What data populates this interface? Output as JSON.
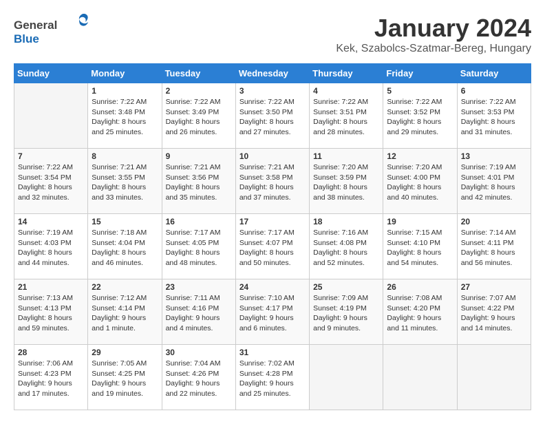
{
  "header": {
    "logo_general": "General",
    "logo_blue": "Blue",
    "month": "January 2024",
    "location": "Kek, Szabolcs-Szatmar-Bereg, Hungary"
  },
  "weekdays": [
    "Sunday",
    "Monday",
    "Tuesday",
    "Wednesday",
    "Thursday",
    "Friday",
    "Saturday"
  ],
  "weeks": [
    [
      {
        "day": "",
        "sunrise": "",
        "sunset": "",
        "daylight": "",
        "empty": true
      },
      {
        "day": "1",
        "sunrise": "Sunrise: 7:22 AM",
        "sunset": "Sunset: 3:48 PM",
        "daylight": "Daylight: 8 hours and 25 minutes."
      },
      {
        "day": "2",
        "sunrise": "Sunrise: 7:22 AM",
        "sunset": "Sunset: 3:49 PM",
        "daylight": "Daylight: 8 hours and 26 minutes."
      },
      {
        "day": "3",
        "sunrise": "Sunrise: 7:22 AM",
        "sunset": "Sunset: 3:50 PM",
        "daylight": "Daylight: 8 hours and 27 minutes."
      },
      {
        "day": "4",
        "sunrise": "Sunrise: 7:22 AM",
        "sunset": "Sunset: 3:51 PM",
        "daylight": "Daylight: 8 hours and 28 minutes."
      },
      {
        "day": "5",
        "sunrise": "Sunrise: 7:22 AM",
        "sunset": "Sunset: 3:52 PM",
        "daylight": "Daylight: 8 hours and 29 minutes."
      },
      {
        "day": "6",
        "sunrise": "Sunrise: 7:22 AM",
        "sunset": "Sunset: 3:53 PM",
        "daylight": "Daylight: 8 hours and 31 minutes."
      }
    ],
    [
      {
        "day": "7",
        "sunrise": "Sunrise: 7:22 AM",
        "sunset": "Sunset: 3:54 PM",
        "daylight": "Daylight: 8 hours and 32 minutes."
      },
      {
        "day": "8",
        "sunrise": "Sunrise: 7:21 AM",
        "sunset": "Sunset: 3:55 PM",
        "daylight": "Daylight: 8 hours and 33 minutes."
      },
      {
        "day": "9",
        "sunrise": "Sunrise: 7:21 AM",
        "sunset": "Sunset: 3:56 PM",
        "daylight": "Daylight: 8 hours and 35 minutes."
      },
      {
        "day": "10",
        "sunrise": "Sunrise: 7:21 AM",
        "sunset": "Sunset: 3:58 PM",
        "daylight": "Daylight: 8 hours and 37 minutes."
      },
      {
        "day": "11",
        "sunrise": "Sunrise: 7:20 AM",
        "sunset": "Sunset: 3:59 PM",
        "daylight": "Daylight: 8 hours and 38 minutes."
      },
      {
        "day": "12",
        "sunrise": "Sunrise: 7:20 AM",
        "sunset": "Sunset: 4:00 PM",
        "daylight": "Daylight: 8 hours and 40 minutes."
      },
      {
        "day": "13",
        "sunrise": "Sunrise: 7:19 AM",
        "sunset": "Sunset: 4:01 PM",
        "daylight": "Daylight: 8 hours and 42 minutes."
      }
    ],
    [
      {
        "day": "14",
        "sunrise": "Sunrise: 7:19 AM",
        "sunset": "Sunset: 4:03 PM",
        "daylight": "Daylight: 8 hours and 44 minutes."
      },
      {
        "day": "15",
        "sunrise": "Sunrise: 7:18 AM",
        "sunset": "Sunset: 4:04 PM",
        "daylight": "Daylight: 8 hours and 46 minutes."
      },
      {
        "day": "16",
        "sunrise": "Sunrise: 7:17 AM",
        "sunset": "Sunset: 4:05 PM",
        "daylight": "Daylight: 8 hours and 48 minutes."
      },
      {
        "day": "17",
        "sunrise": "Sunrise: 7:17 AM",
        "sunset": "Sunset: 4:07 PM",
        "daylight": "Daylight: 8 hours and 50 minutes."
      },
      {
        "day": "18",
        "sunrise": "Sunrise: 7:16 AM",
        "sunset": "Sunset: 4:08 PM",
        "daylight": "Daylight: 8 hours and 52 minutes."
      },
      {
        "day": "19",
        "sunrise": "Sunrise: 7:15 AM",
        "sunset": "Sunset: 4:10 PM",
        "daylight": "Daylight: 8 hours and 54 minutes."
      },
      {
        "day": "20",
        "sunrise": "Sunrise: 7:14 AM",
        "sunset": "Sunset: 4:11 PM",
        "daylight": "Daylight: 8 hours and 56 minutes."
      }
    ],
    [
      {
        "day": "21",
        "sunrise": "Sunrise: 7:13 AM",
        "sunset": "Sunset: 4:13 PM",
        "daylight": "Daylight: 8 hours and 59 minutes."
      },
      {
        "day": "22",
        "sunrise": "Sunrise: 7:12 AM",
        "sunset": "Sunset: 4:14 PM",
        "daylight": "Daylight: 9 hours and 1 minute."
      },
      {
        "day": "23",
        "sunrise": "Sunrise: 7:11 AM",
        "sunset": "Sunset: 4:16 PM",
        "daylight": "Daylight: 9 hours and 4 minutes."
      },
      {
        "day": "24",
        "sunrise": "Sunrise: 7:10 AM",
        "sunset": "Sunset: 4:17 PM",
        "daylight": "Daylight: 9 hours and 6 minutes."
      },
      {
        "day": "25",
        "sunrise": "Sunrise: 7:09 AM",
        "sunset": "Sunset: 4:19 PM",
        "daylight": "Daylight: 9 hours and 9 minutes."
      },
      {
        "day": "26",
        "sunrise": "Sunrise: 7:08 AM",
        "sunset": "Sunset: 4:20 PM",
        "daylight": "Daylight: 9 hours and 11 minutes."
      },
      {
        "day": "27",
        "sunrise": "Sunrise: 7:07 AM",
        "sunset": "Sunset: 4:22 PM",
        "daylight": "Daylight: 9 hours and 14 minutes."
      }
    ],
    [
      {
        "day": "28",
        "sunrise": "Sunrise: 7:06 AM",
        "sunset": "Sunset: 4:23 PM",
        "daylight": "Daylight: 9 hours and 17 minutes."
      },
      {
        "day": "29",
        "sunrise": "Sunrise: 7:05 AM",
        "sunset": "Sunset: 4:25 PM",
        "daylight": "Daylight: 9 hours and 19 minutes."
      },
      {
        "day": "30",
        "sunrise": "Sunrise: 7:04 AM",
        "sunset": "Sunset: 4:26 PM",
        "daylight": "Daylight: 9 hours and 22 minutes."
      },
      {
        "day": "31",
        "sunrise": "Sunrise: 7:02 AM",
        "sunset": "Sunset: 4:28 PM",
        "daylight": "Daylight: 9 hours and 25 minutes."
      },
      {
        "day": "",
        "sunrise": "",
        "sunset": "",
        "daylight": "",
        "empty": true
      },
      {
        "day": "",
        "sunrise": "",
        "sunset": "",
        "daylight": "",
        "empty": true
      },
      {
        "day": "",
        "sunrise": "",
        "sunset": "",
        "daylight": "",
        "empty": true
      }
    ]
  ]
}
